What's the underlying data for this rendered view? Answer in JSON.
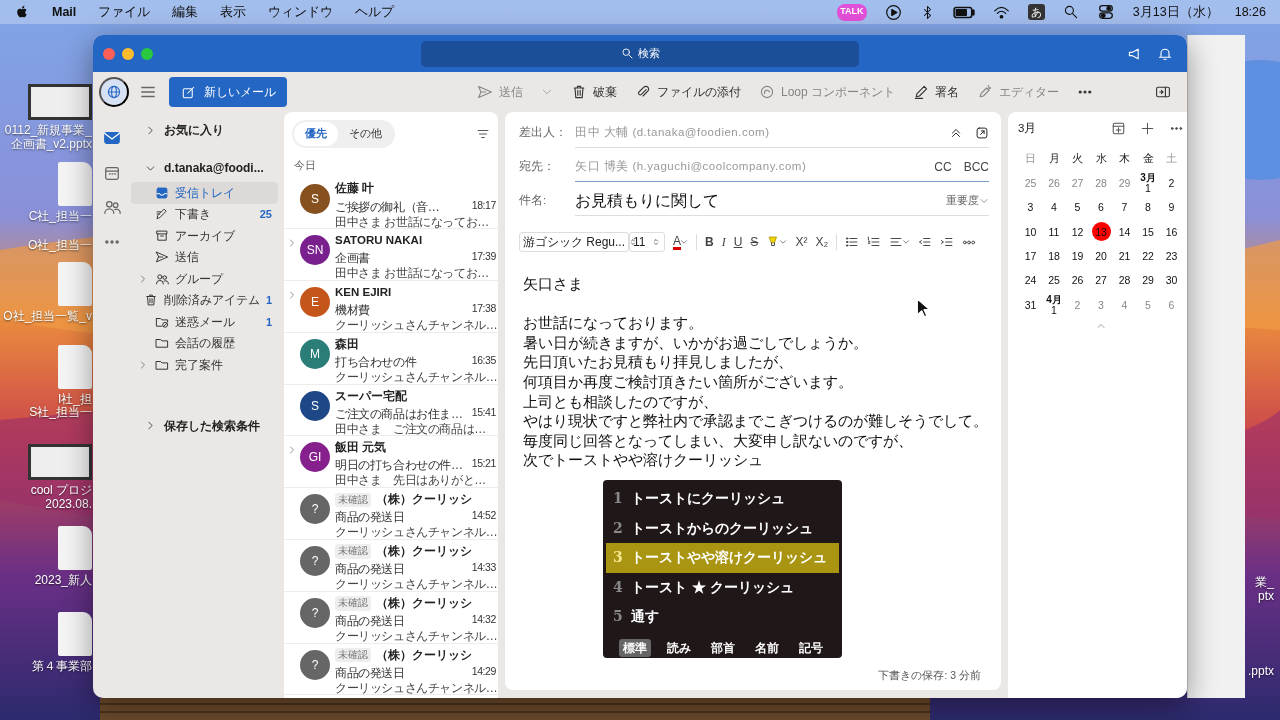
{
  "menubar": {
    "app": "Mail",
    "menus": [
      "ファイル",
      "編集",
      "表示",
      "ウィンドウ",
      "ヘルプ"
    ],
    "talk": "TALK",
    "input_mode": "あ",
    "date": "3月13日（水）",
    "time": "18:26"
  },
  "desktop_icons": [
    {
      "kind": "pptx",
      "lines": [
        "0112_新規事業_",
        "企画書_v2.pptx"
      ]
    },
    {
      "kind": "docx",
      "lines": [
        "C社_担当一"
      ]
    },
    {
      "kind": "label",
      "lines": [
        "O社_担当一"
      ]
    },
    {
      "kind": "docx",
      "lines": [
        "O社_担当一覧_v"
      ]
    },
    {
      "kind": "docx",
      "lines": [
        "I社_担"
      ]
    },
    {
      "kind": "label",
      "lines": [
        "S社_担当一"
      ]
    },
    {
      "kind": "pptx",
      "lines": [
        "cool プロジ",
        "2023.08."
      ]
    },
    {
      "kind": "docx",
      "lines": [
        "2023_新人"
      ]
    },
    {
      "kind": "docx",
      "lines": [
        "第４事業部"
      ]
    },
    {
      "kind": "label",
      "lines": [
        "業_",
        "ptx"
      ]
    },
    {
      "kind": "label",
      "lines": [
        ".pptx"
      ]
    }
  ],
  "window": {
    "search_placeholder": "検索"
  },
  "toolbar": {
    "new_mail": "新しいメール",
    "actions": [
      {
        "kind": "send",
        "label": "送信",
        "disabled": true
      },
      {
        "kind": "trash",
        "label": "破棄",
        "disabled": false
      },
      {
        "kind": "paperclip",
        "label": "ファイルの添付",
        "disabled": false
      },
      {
        "kind": "loop",
        "label": "Loop コンポーネント",
        "disabled": true
      },
      {
        "kind": "pen",
        "label": "署名",
        "disabled": false
      },
      {
        "kind": "editor",
        "label": "エディター",
        "disabled": true
      }
    ]
  },
  "rail": [
    {
      "kind": "mail",
      "selected": true
    },
    {
      "kind": "calendar",
      "selected": false
    },
    {
      "kind": "people",
      "selected": false
    },
    {
      "kind": "dots",
      "selected": false
    }
  ],
  "folders": {
    "favorites": "お気に入り",
    "account": "d.tanaka@foodi...",
    "items": [
      {
        "kind": "inbox",
        "label": "受信トレイ",
        "selected": true,
        "expandable": false
      },
      {
        "kind": "draft",
        "label": "下書き",
        "count": "25",
        "selected": false,
        "expandable": false
      },
      {
        "kind": "archive",
        "label": "アーカイブ",
        "selected": false,
        "expandable": false
      },
      {
        "kind": "send",
        "label": "送信",
        "selected": false,
        "expandable": false
      },
      {
        "kind": "people",
        "label": "グループ",
        "selected": false,
        "expandable": true
      },
      {
        "kind": "trash",
        "label": "削除済みアイテム",
        "count": "1",
        "selected": false,
        "expandable": false
      },
      {
        "kind": "junk",
        "label": "迷惑メール",
        "count": "1",
        "selected": false,
        "expandable": false
      },
      {
        "kind": "folder",
        "label": "会話の履歴",
        "selected": false,
        "expandable": false
      },
      {
        "kind": "folder",
        "label": "完了案件",
        "selected": false,
        "expandable": true
      }
    ],
    "saved_searches": "保存した検索条件"
  },
  "message_list": {
    "tabs": [
      {
        "label": "優先",
        "selected": true
      },
      {
        "label": "その他",
        "selected": false
      }
    ],
    "group": "今日",
    "messages": [
      {
        "initials": "S",
        "color": "#86501f",
        "sender": "佐藤 叶",
        "subject": "ご挨拶の御礼（音…",
        "time": "18:17",
        "preview": "田中さま お世話になってお…",
        "expandable": false
      },
      {
        "initials": "SN",
        "color": "#7a1f8e",
        "sender": "SATORU NAKAI",
        "subject": "企画書",
        "time": "17:39",
        "preview": "田中さま お世話になってお…",
        "expandable": true
      },
      {
        "initials": "E",
        "color": "#c4561c",
        "sender": "KEN EJIRI",
        "subject": "機材費",
        "time": "17:38",
        "preview": "クーリッシュさんチャンネル…",
        "expandable": true
      },
      {
        "initials": "M",
        "color": "#2b7d78",
        "sender": "森田",
        "subject": "打ち合わせの件",
        "time": "16:35",
        "preview": "クーリッシュさんチャンネル…",
        "expandable": false
      },
      {
        "initials": "S",
        "color": "#1d4787",
        "sender": "スーパー宅配",
        "subject": "ご注文の商品はお住ま…",
        "time": "15:41",
        "preview": "田中さま　ご注文の商品は…",
        "expandable": false
      },
      {
        "initials": "GI",
        "color": "#85208c",
        "sender": "飯田 元気",
        "subject": "明日の打ち合わせの件…",
        "time": "15:21",
        "preview": "田中さま　先日はありがと…",
        "expandable": true
      },
      {
        "initials": "?",
        "color": "#666666",
        "tag": "未確認",
        "sender": "（株）クーリッシ",
        "subject": "商品の発送日",
        "time": "14:52",
        "preview": "クーリッシュさんチャンネル…",
        "expandable": false
      },
      {
        "initials": "?",
        "color": "#666666",
        "tag": "未確認",
        "sender": "（株）クーリッシ",
        "subject": "商品の発送日",
        "time": "14:33",
        "preview": "クーリッシュさんチャンネル…",
        "expandable": false
      },
      {
        "initials": "?",
        "color": "#666666",
        "tag": "未確認",
        "sender": "（株）クーリッシ",
        "subject": "商品の発送日",
        "time": "14:32",
        "preview": "クーリッシュさんチャンネル…",
        "expandable": false
      },
      {
        "initials": "?",
        "color": "#666666",
        "tag": "未確認",
        "sender": "（株）クーリッシ",
        "subject": "商品の発送日",
        "time": "14:29",
        "preview": "クーリッシュさんチャンネル…",
        "expandable": false
      }
    ]
  },
  "compose": {
    "from_label": "差出人：",
    "from": "田中 大輔 (d.tanaka@foodien.com)",
    "to_label": "宛先：",
    "to": "矢口 博美 (h.yaguchi@coolcompany.com)",
    "cc": "CC",
    "bcc": "BCC",
    "subject_label": "件名:",
    "subject": "お見積もりに関して",
    "importance": "重要度",
    "font": "游ゴシック Regu...",
    "size": "11",
    "format_buttons": [
      {
        "kind": "font-color",
        "text": "A"
      },
      {
        "kind": "bold",
        "text": "B"
      },
      {
        "kind": "italic",
        "text": "I"
      },
      {
        "kind": "underline",
        "text": "U"
      },
      {
        "kind": "strike",
        "text": "S"
      },
      {
        "kind": "highlight"
      },
      {
        "kind": "superscript",
        "text": "X²"
      },
      {
        "kind": "subscript",
        "text": "X₂"
      },
      {
        "kind": "bullets"
      },
      {
        "kind": "numbering"
      },
      {
        "kind": "align"
      },
      {
        "kind": "outdent"
      },
      {
        "kind": "indent"
      },
      {
        "kind": "more"
      }
    ],
    "body": [
      {
        "lines": [
          "矢口さま"
        ]
      },
      {
        "lines": [
          "お世話になっております。",
          "暑い日が続きますが、いかがお過ごしでしょうか。",
          "先日頂いたお見積もり拝見しましたが、",
          "何項目か再度ご検討頂きたい箇所がございます。",
          "上司とも相談したのですが、",
          "やはり現状ですと弊社内で承認までこぎつけるのが難しそうでして。",
          "毎度同じ回答となってしまい、大変申し訳ないのですが、",
          "次でトーストやや溶けクーリッシュ"
        ]
      }
    ],
    "saved": "下書きの保存: 3 分前"
  },
  "ime": {
    "candidates": [
      {
        "number": "1",
        "text": "トーストにクーリッシュ",
        "selected": false
      },
      {
        "number": "2",
        "text": "トーストからのクーリッシュ",
        "selected": false
      },
      {
        "number": "3",
        "text": "トーストやや溶けクーリッシュ",
        "selected": true
      },
      {
        "number": "4",
        "text": "トースト ★ クーリッシュ",
        "selected": false
      },
      {
        "number": "5",
        "text": "通す",
        "selected": false
      }
    ],
    "tabs": [
      {
        "label": "標準",
        "selected": true
      },
      {
        "label": "読み",
        "selected": false
      },
      {
        "label": "部首",
        "selected": false
      },
      {
        "label": "名前",
        "selected": false
      },
      {
        "label": "記号",
        "selected": false
      }
    ]
  },
  "calendar": {
    "month": "3月",
    "weekdays": [
      "日",
      "月",
      "火",
      "水",
      "木",
      "金",
      "土"
    ],
    "weeks": [
      [
        {
          "day": "25",
          "muted": true
        },
        {
          "day": "26",
          "muted": true
        },
        {
          "day": "27",
          "muted": true
        },
        {
          "day": "28",
          "muted": true
        },
        {
          "day": "29",
          "muted": true
        },
        {
          "month": "3月",
          "day": "1",
          "muted": false
        },
        {
          "day": "2",
          "muted": false
        }
      ],
      [
        {
          "day": "3",
          "muted": false
        },
        {
          "day": "4",
          "muted": false
        },
        {
          "day": "5",
          "muted": false
        },
        {
          "day": "6",
          "muted": false
        },
        {
          "day": "7",
          "muted": false
        },
        {
          "day": "8",
          "muted": false
        },
        {
          "day": "9",
          "muted": false
        }
      ],
      [
        {
          "day": "10",
          "muted": false
        },
        {
          "day": "11",
          "muted": false
        },
        {
          "day": "12",
          "muted": false
        },
        {
          "day": "13",
          "muted": false,
          "today": true
        },
        {
          "day": "14",
          "muted": false
        },
        {
          "day": "15",
          "muted": false
        },
        {
          "day": "16",
          "muted": false
        }
      ],
      [
        {
          "day": "17",
          "muted": false
        },
        {
          "day": "18",
          "muted": false
        },
        {
          "day": "19",
          "muted": false
        },
        {
          "day": "20",
          "muted": false
        },
        {
          "day": "21",
          "muted": false
        },
        {
          "day": "22",
          "muted": false
        },
        {
          "day": "23",
          "muted": false
        }
      ],
      [
        {
          "day": "24",
          "muted": false
        },
        {
          "day": "25",
          "muted": false
        },
        {
          "day": "26",
          "muted": false
        },
        {
          "day": "27",
          "muted": false
        },
        {
          "day": "28",
          "muted": false
        },
        {
          "day": "29",
          "muted": false
        },
        {
          "day": "30",
          "muted": false
        }
      ],
      [
        {
          "day": "31",
          "muted": false
        },
        {
          "month": "4月",
          "day": "1",
          "muted": false
        },
        {
          "day": "2",
          "muted": true
        },
        {
          "day": "3",
          "muted": true
        },
        {
          "day": "4",
          "muted": true
        },
        {
          "day": "5",
          "muted": true
        },
        {
          "day": "6",
          "muted": true
        }
      ]
    ]
  }
}
